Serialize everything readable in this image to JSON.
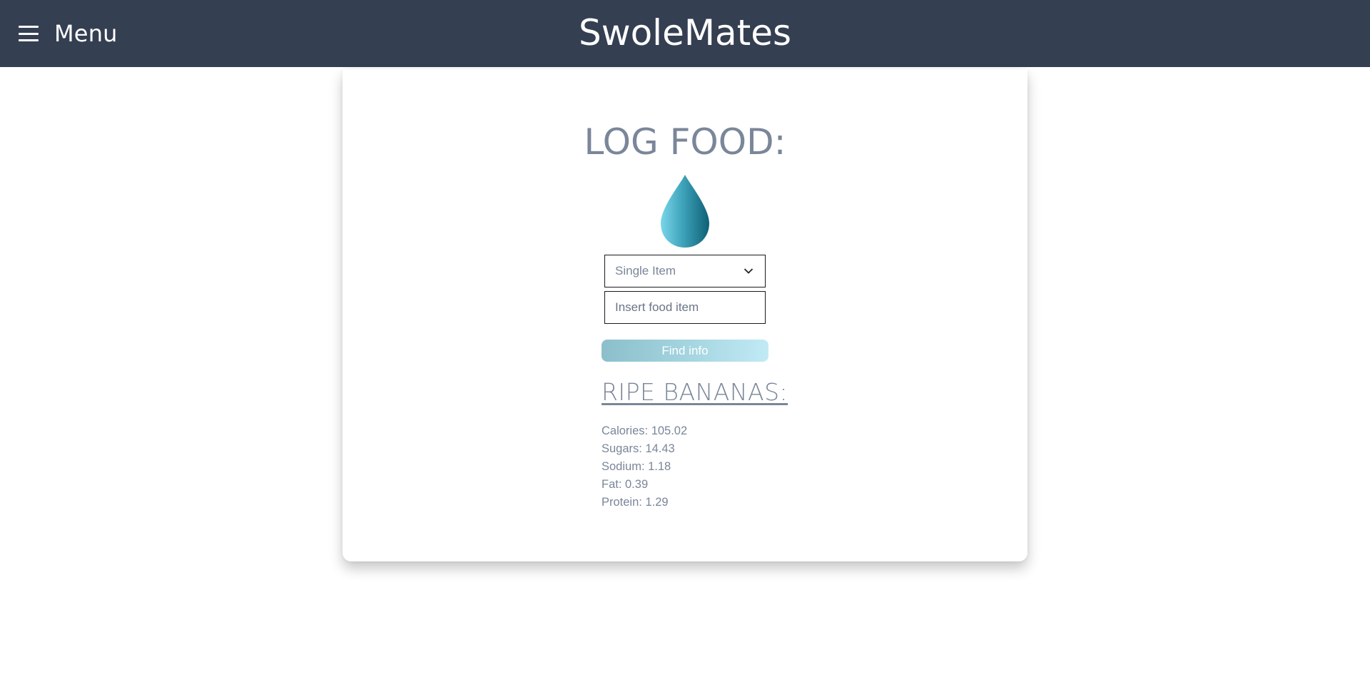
{
  "header": {
    "menu_label": "Menu",
    "app_title": "SwoleMates"
  },
  "main": {
    "heading": "LOG FOOD:",
    "icon": "water-drop-icon",
    "mode_select": {
      "selected": "Single Item"
    },
    "food_input": {
      "value": "",
      "placeholder": "Insert food item"
    },
    "find_button_label": "Find info",
    "result": {
      "title": "RIPE BANANAS:",
      "nutrients": [
        {
          "text": "Calories: 105.02"
        },
        {
          "text": "Sugars: 14.43"
        },
        {
          "text": "Sodium: 1.18"
        },
        {
          "text": "Fat: 0.39"
        },
        {
          "text": "Protein: 1.29"
        }
      ]
    }
  },
  "colors": {
    "header_bg": "#353f52",
    "text_muted": "#7a8699",
    "drop_light": "#7ad6ea",
    "drop_dark": "#0e6076"
  }
}
